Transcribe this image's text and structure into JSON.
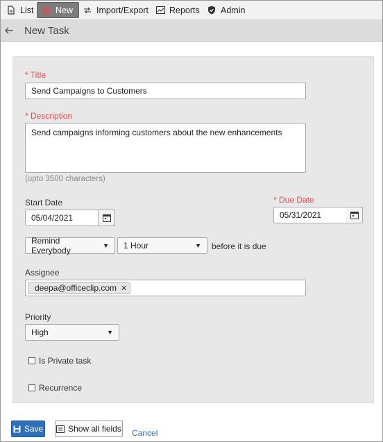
{
  "nav": {
    "list": "List",
    "new": "New",
    "import_export": "Import/Export",
    "reports": "Reports",
    "admin": "Admin"
  },
  "page": {
    "title": "New Task"
  },
  "form": {
    "title_label": "Title",
    "title_value": "Send Campaigns to Customers",
    "description_label": "Description",
    "description_value": "Send campaigns informing customers about the new enhancements",
    "description_hint": "(upto 3500 characters)",
    "start_date_label": "Start Date",
    "start_date_value": "05/04/2021",
    "due_date_label": "Due Date",
    "due_date_value": "05/31/2021",
    "remind_who": "Remind Everybody",
    "remind_when": "1 Hour",
    "remind_suffix": "before it is due",
    "assignee_label": "Assignee",
    "assignee_tag": "deepa@officeclip.com",
    "priority_label": "Priority",
    "priority_value": "High",
    "private_label": "Is Private task",
    "recurrence_label": "Recurrence",
    "required_mark": "*"
  },
  "actions": {
    "save": "Save",
    "show_all": "Show all fields",
    "cancel": "Cancel"
  },
  "colors": {
    "accent": "#2e6fba",
    "required": "#e8464b",
    "panel": "#e8e8e8"
  }
}
